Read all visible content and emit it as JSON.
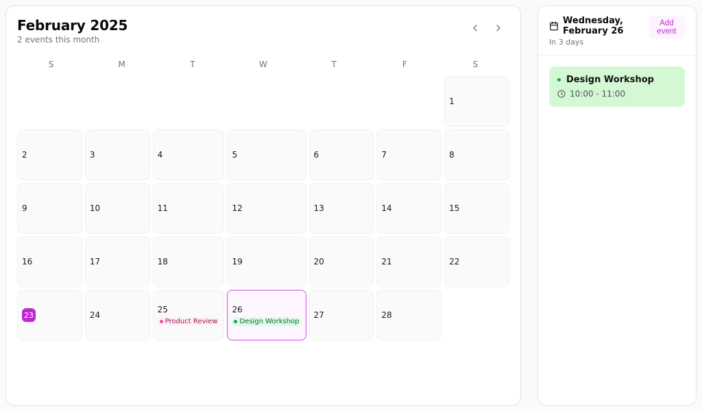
{
  "calendar": {
    "title": "February 2025",
    "subtitle": "2 events this month",
    "days_of_week": [
      "S",
      "M",
      "T",
      "W",
      "T",
      "F",
      "S"
    ]
  },
  "cells": [
    {
      "n": "",
      "out": true
    },
    {
      "n": "",
      "out": true
    },
    {
      "n": "",
      "out": true
    },
    {
      "n": "",
      "out": true
    },
    {
      "n": "",
      "out": true
    },
    {
      "n": "",
      "out": true
    },
    {
      "n": "1"
    },
    {
      "n": "2"
    },
    {
      "n": "3"
    },
    {
      "n": "4"
    },
    {
      "n": "5"
    },
    {
      "n": "6"
    },
    {
      "n": "7"
    },
    {
      "n": "8"
    },
    {
      "n": "9"
    },
    {
      "n": "10"
    },
    {
      "n": "11"
    },
    {
      "n": "12"
    },
    {
      "n": "13"
    },
    {
      "n": "14"
    },
    {
      "n": "15"
    },
    {
      "n": "16"
    },
    {
      "n": "17"
    },
    {
      "n": "18"
    },
    {
      "n": "19"
    },
    {
      "n": "20"
    },
    {
      "n": "21"
    },
    {
      "n": "22"
    },
    {
      "n": "23",
      "today": true
    },
    {
      "n": "24"
    },
    {
      "n": "25",
      "chips": [
        {
          "label": "Product Review",
          "variant": "pink"
        }
      ]
    },
    {
      "n": "26",
      "selected": true,
      "chips": [
        {
          "label": "Design Workshop",
          "variant": "green"
        }
      ]
    },
    {
      "n": "27"
    },
    {
      "n": "28"
    },
    {
      "n": "",
      "out": true
    },
    {
      "n": "",
      "out": true
    },
    {
      "n": "",
      "out": true
    },
    {
      "n": "",
      "out": true
    },
    {
      "n": "",
      "out": true
    },
    {
      "n": "",
      "out": true
    },
    {
      "n": "",
      "out": true
    },
    {
      "n": "",
      "out": true
    }
  ],
  "side": {
    "date_label": "Wednesday, February 26",
    "relative": "In 3 days",
    "add_label": "Add event",
    "events": [
      {
        "title": "Design Workshop",
        "time": "10:00 - 11:00",
        "variant": "green"
      }
    ]
  }
}
